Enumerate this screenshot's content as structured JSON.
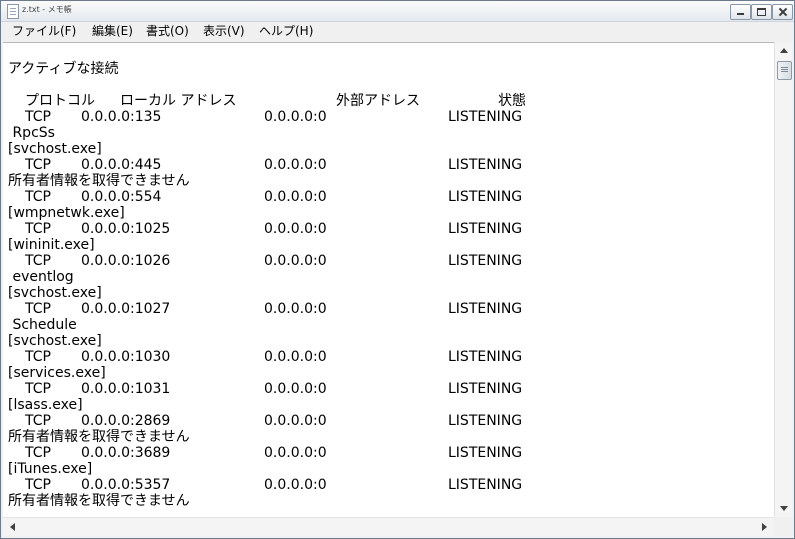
{
  "window": {
    "title": "z.txt - メモ帳"
  },
  "menu": [
    "ファイル(F)",
    "編集(E)",
    "書式(O)",
    "表示(V)",
    "ヘルプ(H)"
  ],
  "content": {
    "heading": "アクティブな接続",
    "columns": [
      "プロトコル",
      "ローカル アドレス",
      "外部アドレス",
      "状態"
    ],
    "rows": [
      {
        "proto": "TCP",
        "local": "0.0.0.0:135",
        "foreign": "0.0.0.0:0",
        "state": "LISTENING"
      },
      {
        "text": " RpcSs"
      },
      {
        "text": "[svchost.exe]"
      },
      {
        "proto": "TCP",
        "local": "0.0.0.0:445",
        "foreign": "0.0.0.0:0",
        "state": "LISTENING"
      },
      {
        "text": "所有者情報を取得できません"
      },
      {
        "proto": "TCP",
        "local": "0.0.0.0:554",
        "foreign": "0.0.0.0:0",
        "state": "LISTENING"
      },
      {
        "text": "[wmpnetwk.exe]"
      },
      {
        "proto": "TCP",
        "local": "0.0.0.0:1025",
        "foreign": "0.0.0.0:0",
        "state": "LISTENING"
      },
      {
        "text": "[wininit.exe]"
      },
      {
        "proto": "TCP",
        "local": "0.0.0.0:1026",
        "foreign": "0.0.0.0:0",
        "state": "LISTENING"
      },
      {
        "text": " eventlog"
      },
      {
        "text": "[svchost.exe]"
      },
      {
        "proto": "TCP",
        "local": "0.0.0.0:1027",
        "foreign": "0.0.0.0:0",
        "state": "LISTENING"
      },
      {
        "text": " Schedule"
      },
      {
        "text": "[svchost.exe]"
      },
      {
        "proto": "TCP",
        "local": "0.0.0.0:1030",
        "foreign": "0.0.0.0:0",
        "state": "LISTENING"
      },
      {
        "text": "[services.exe]"
      },
      {
        "proto": "TCP",
        "local": "0.0.0.0:1031",
        "foreign": "0.0.0.0:0",
        "state": "LISTENING"
      },
      {
        "text": "[lsass.exe]"
      },
      {
        "proto": "TCP",
        "local": "0.0.0.0:2869",
        "foreign": "0.0.0.0:0",
        "state": "LISTENING"
      },
      {
        "text": "所有者情報を取得できません"
      },
      {
        "proto": "TCP",
        "local": "0.0.0.0:3689",
        "foreign": "0.0.0.0:0",
        "state": "LISTENING"
      },
      {
        "text": "[iTunes.exe]"
      },
      {
        "proto": "TCP",
        "local": "0.0.0.0:5357",
        "foreign": "0.0.0.0:0",
        "state": "LISTENING"
      },
      {
        "text": "所有者情報を取得できません"
      }
    ]
  }
}
